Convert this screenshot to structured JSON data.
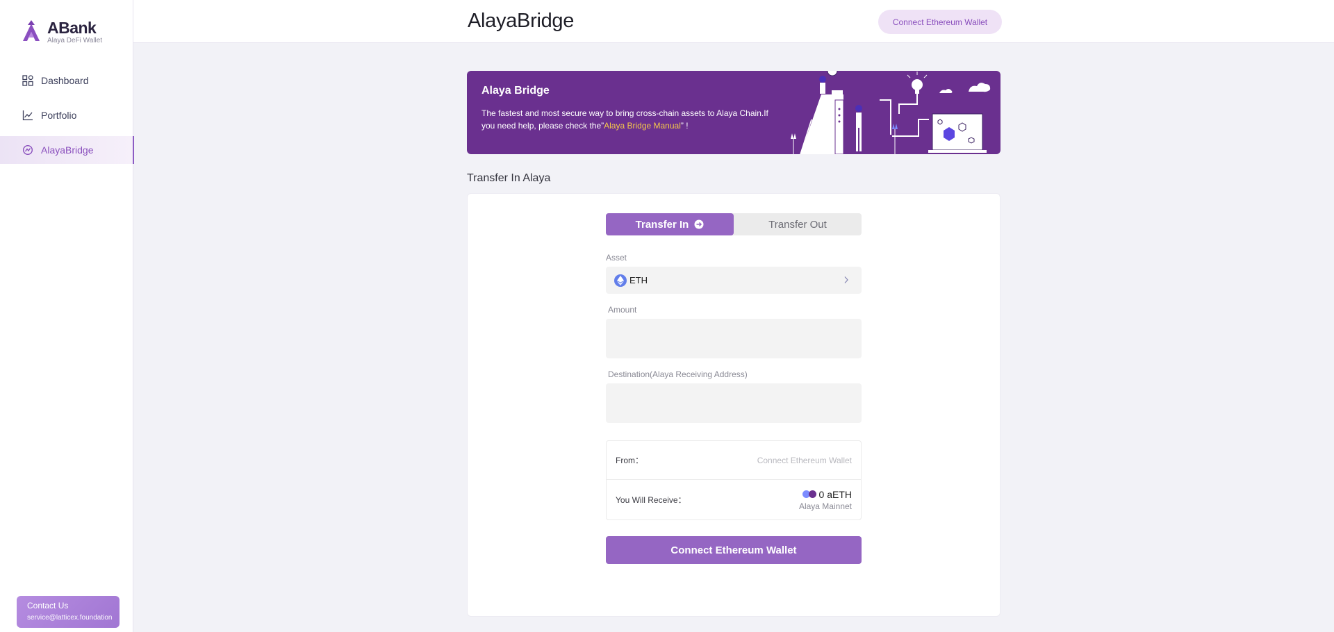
{
  "brand": {
    "name": "ABank",
    "subtitle": "Alaya DeFi Wallet",
    "accent": "#9566c3",
    "banner_bg": "#6a308f"
  },
  "sidebar": {
    "items": [
      {
        "label": "Dashboard",
        "icon": "grid-icon",
        "active": false
      },
      {
        "label": "Portfolio",
        "icon": "chart-line-icon",
        "active": false
      },
      {
        "label": "AlayaBridge",
        "icon": "bridge-icon",
        "active": true
      }
    ],
    "contact": {
      "title": "Contact Us",
      "email": "service@latticex.foundation"
    }
  },
  "header": {
    "title": "AlayaBridge",
    "connect_button": "Connect Ethereum Wallet"
  },
  "banner": {
    "title": "Alaya Bridge",
    "desc_before": "The fastest and most secure way to bring cross-chain assets to Alaya Chain.If you need help, please check the”",
    "link": "Alaya Bridge Manual",
    "desc_after": "” !"
  },
  "section_title": "Transfer In Alaya",
  "form": {
    "tabs": [
      {
        "label": "Transfer In",
        "active": true
      },
      {
        "label": "Transfer Out",
        "active": false
      }
    ],
    "asset_label": "Asset",
    "asset_value": "ETH",
    "amount_label": "Amount",
    "amount_value": "",
    "destination_label": "Destination(Alaya Receiving Address)",
    "destination_value": "",
    "summary": {
      "from_label": "From：",
      "from_value": "Connect Ethereum Wallet",
      "receive_label": "You Will Receive：",
      "receive_amount": "0 aETH",
      "receive_network": "Alaya Mainnet"
    },
    "submit_button": "Connect Ethereum Wallet"
  }
}
